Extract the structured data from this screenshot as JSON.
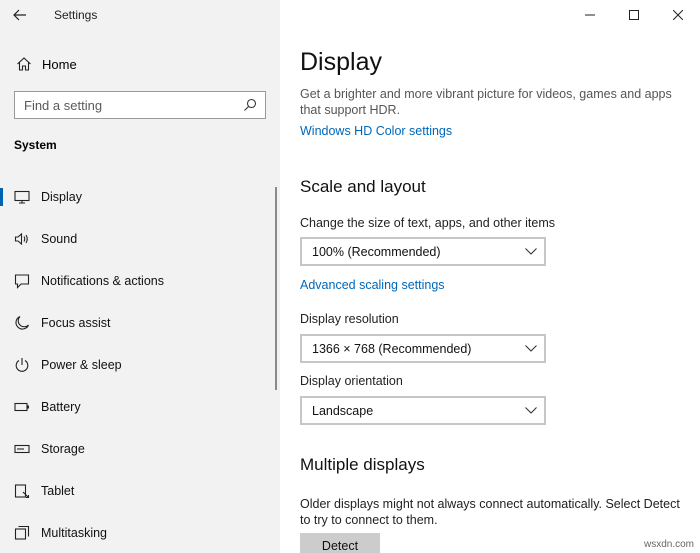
{
  "app": {
    "title": "Settings"
  },
  "sidebar": {
    "home_label": "Home",
    "search_placeholder": "Find a setting",
    "section_title": "System",
    "items": [
      {
        "label": "Display",
        "icon": "monitor-icon",
        "active": true
      },
      {
        "label": "Sound",
        "icon": "speaker-icon"
      },
      {
        "label": "Notifications & actions",
        "icon": "notification-icon"
      },
      {
        "label": "Focus assist",
        "icon": "moon-icon"
      },
      {
        "label": "Power & sleep",
        "icon": "power-icon"
      },
      {
        "label": "Battery",
        "icon": "battery-icon"
      },
      {
        "label": "Storage",
        "icon": "storage-icon"
      },
      {
        "label": "Tablet",
        "icon": "tablet-icon"
      },
      {
        "label": "Multitasking",
        "icon": "multitasking-icon"
      }
    ]
  },
  "main": {
    "title": "Display",
    "hdr_description": "Get a brighter and more vibrant picture for videos, games and apps that support HDR.",
    "hdr_link": "Windows HD Color settings",
    "scale_heading": "Scale and layout",
    "scale_label": "Change the size of text, apps, and other items",
    "scale_value": "100% (Recommended)",
    "advanced_link": "Advanced scaling settings",
    "resolution_label": "Display resolution",
    "resolution_value": "1366 × 768 (Recommended)",
    "orientation_label": "Display orientation",
    "orientation_value": "Landscape",
    "multiple_heading": "Multiple displays",
    "multiple_text": "Older displays might not always connect automatically. Select Detect to try to connect to them.",
    "detect_button": "Detect"
  },
  "watermark": "wsxdn.com",
  "colors": {
    "accent": "#0063b1",
    "link": "#0067b8",
    "sidebar_bg": "#f2f2f2"
  }
}
